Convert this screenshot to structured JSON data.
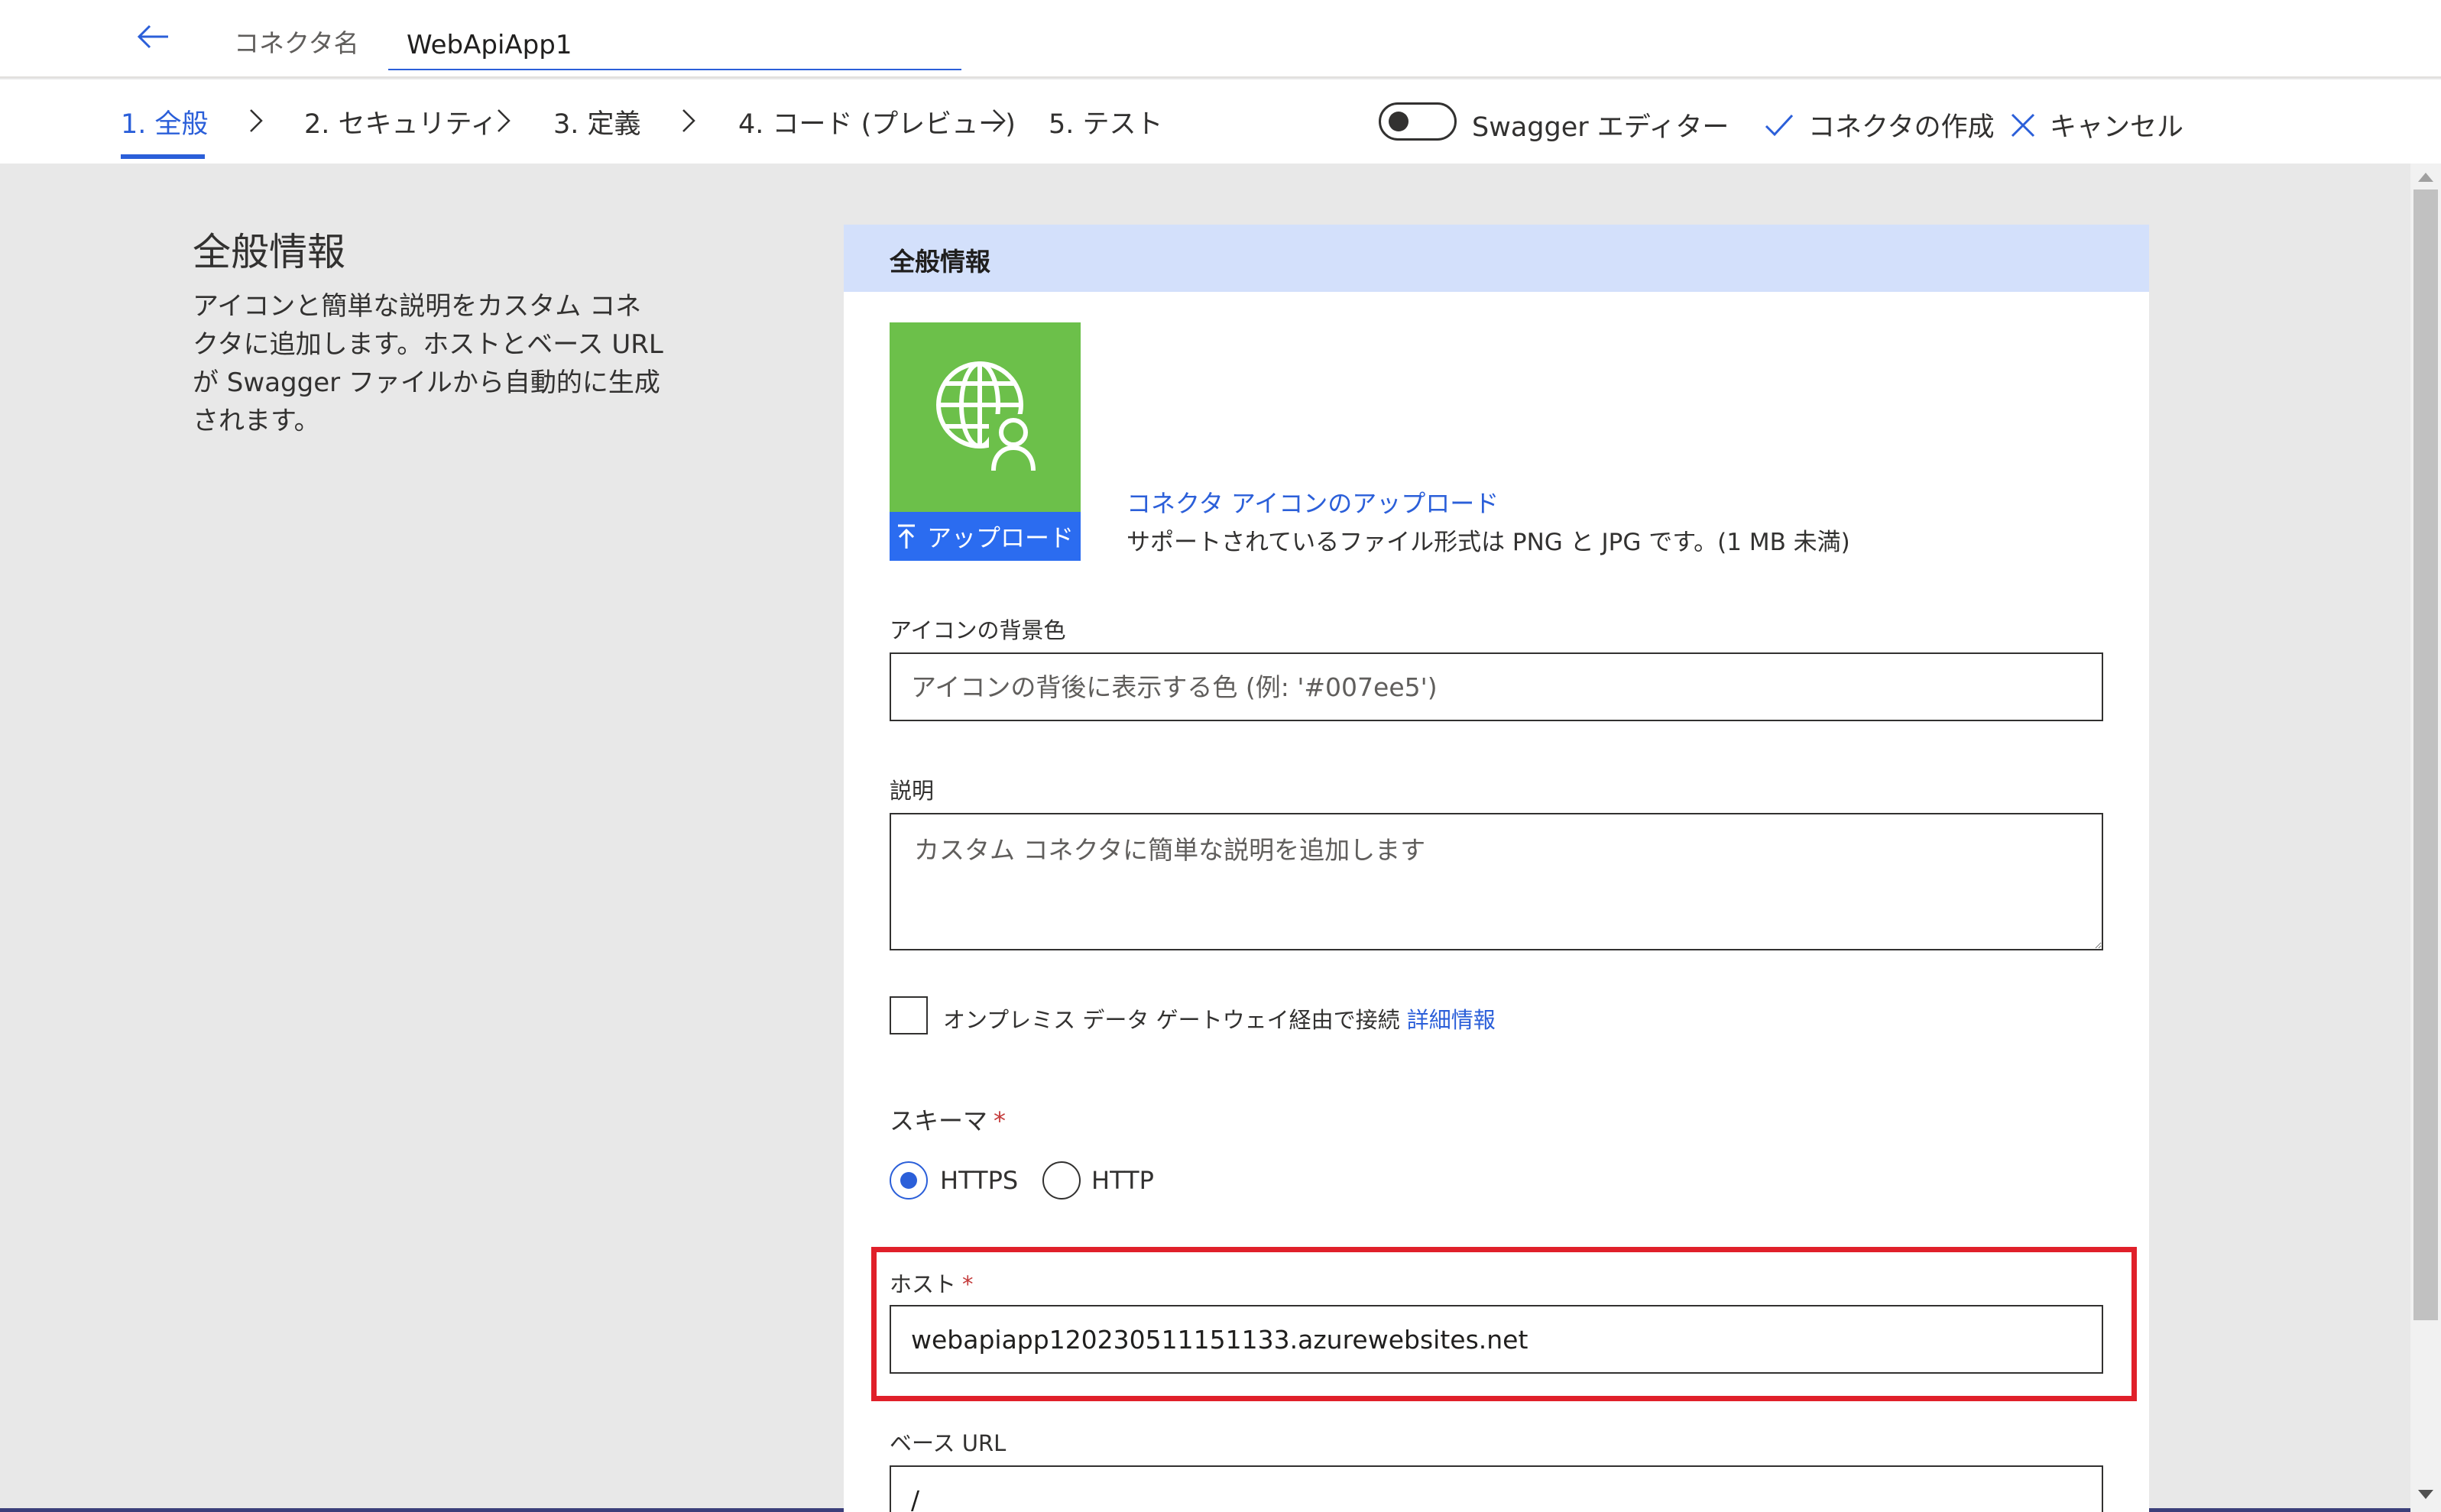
{
  "header": {
    "connector_name_label": "コネクタ名",
    "connector_name_value": "WebApiApp1"
  },
  "steps": [
    {
      "label": "1. 全般",
      "active": true
    },
    {
      "label": "2. セキュリティ",
      "active": false
    },
    {
      "label": "3. 定義",
      "active": false
    },
    {
      "label": "4. コード (プレビュー)",
      "active": false
    },
    {
      "label": "5. テスト",
      "active": false
    }
  ],
  "commands": {
    "swagger_editor_label": "Swagger エディター",
    "swagger_editor_on": false,
    "create_connector_label": "コネクタの作成",
    "cancel_label": "キャンセル"
  },
  "sidebar": {
    "title": "全般情報",
    "description": "アイコンと簡単な説明をカスタム コネクタに追加します。ホストとベース URL が Swagger ファイルから自動的に生成されます。"
  },
  "panel": {
    "title": "全般情報",
    "icon": {
      "name": "globe-user-icon",
      "background": "#6cc04a",
      "upload_button_label": "アップロード",
      "upload_link": "コネクタ アイコンのアップロード",
      "upload_note": "サポートされているファイル形式は PNG と JPG です。(1 MB 未満)"
    },
    "icon_bg_color": {
      "label": "アイコンの背景色",
      "value": "",
      "placeholder": "アイコンの背後に表示する色 (例: '#007ee5')"
    },
    "description": {
      "label": "説明",
      "value": "",
      "placeholder": "カスタム コネクタに簡単な説明を追加します"
    },
    "on_prem": {
      "label": "オンプレミス データ ゲートウェイ経由で接続",
      "link": "詳細情報",
      "checked": false
    },
    "scheme": {
      "label": "スキーマ",
      "required_mark": "*",
      "options": [
        "HTTPS",
        "HTTP"
      ],
      "selected": "HTTPS"
    },
    "host": {
      "label": "ホスト",
      "required_mark": "*",
      "value": "webapiapp120230511151133.azurewebsites.net"
    },
    "base_url": {
      "label": "ベース URL",
      "value": "/"
    }
  },
  "colors": {
    "accent": "#2b5fd9",
    "header_band": "#d3e0fb",
    "highlight": "#e0202a"
  }
}
